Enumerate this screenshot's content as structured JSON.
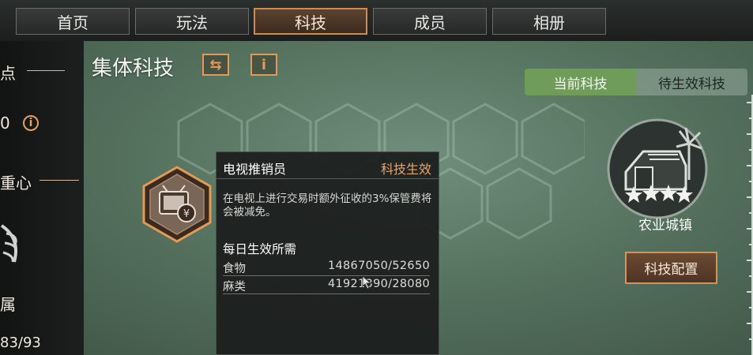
{
  "tabs": [
    {
      "label": "首页",
      "active": false
    },
    {
      "label": "玩法",
      "active": false
    },
    {
      "label": "科技",
      "active": true
    },
    {
      "label": "成员",
      "active": false
    },
    {
      "label": "相册",
      "active": false
    }
  ],
  "left_panel": {
    "text_1": "点",
    "value_1": "0",
    "text_2": "重心",
    "text_3": "属",
    "count": "83/93"
  },
  "heading": "集体科技",
  "toggle": {
    "current": "当前科技",
    "pending": "待生效科技"
  },
  "tooltip": {
    "title": "电视推销员",
    "status": "科技生效",
    "description": "在电视上进行交易时额外征收的3%保管费将会被减免。",
    "requirements_title": "每日生效所需",
    "requirements": [
      {
        "name": "食物",
        "value": "14867050/52650"
      },
      {
        "name": "麻类",
        "value": "41921390/28080"
      }
    ]
  },
  "town": {
    "label": "农业城镇"
  },
  "config_button": "科技配置",
  "colors": {
    "accent": "#e39a54",
    "toggle_active": "#6f9c58",
    "background": "#56735f"
  }
}
